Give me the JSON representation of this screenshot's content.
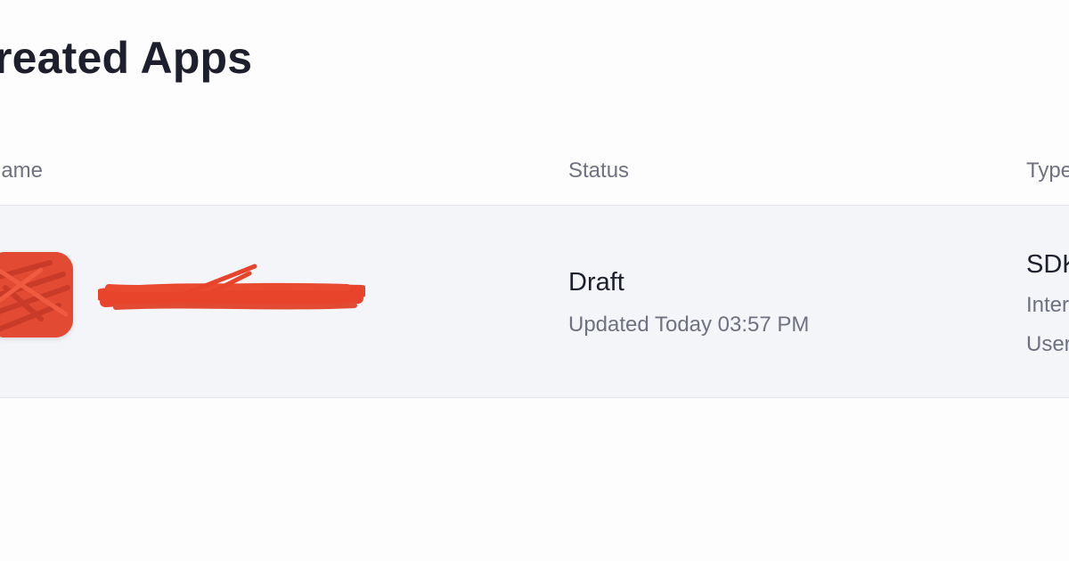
{
  "page": {
    "title": "reated Apps"
  },
  "table": {
    "columns": {
      "name": "lame",
      "status": "Status",
      "type": "Type"
    },
    "rows": [
      {
        "name": "",
        "status": "Draft",
        "updated": "Updated Today 03:57 PM",
        "type": "SDK",
        "type_detail_1": "Inter",
        "type_detail_2": "User"
      }
    ]
  },
  "colors": {
    "redaction": "#e24a33",
    "row_background": "#f4f5f9"
  }
}
